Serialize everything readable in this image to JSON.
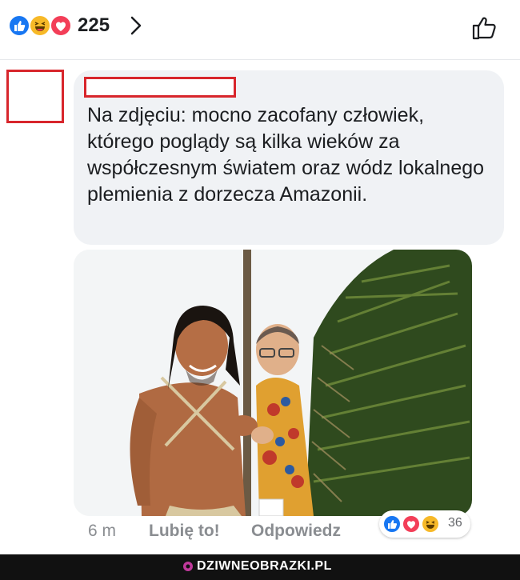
{
  "reactions": {
    "count": "225",
    "icons": [
      "like-icon",
      "haha-icon",
      "love-icon"
    ],
    "colors": {
      "like": "#1877f2",
      "haha": "#f7b928",
      "love": "#f33e58"
    }
  },
  "comment": {
    "text": "Na zdjęciu: mocno zacofany człowiek, którego poglądy są kilka wieków za współczesnym światem oraz wódz lokalnego plemienia z dorzecza Amazonii.",
    "time": "6 m",
    "like_label": "Lubię to!",
    "reply_label": "Odpowiedz",
    "reaction_count": "36"
  },
  "redaction_color": "#d8262c",
  "footer": {
    "watermark": "DZIWNEOBRAZKI.PL"
  }
}
